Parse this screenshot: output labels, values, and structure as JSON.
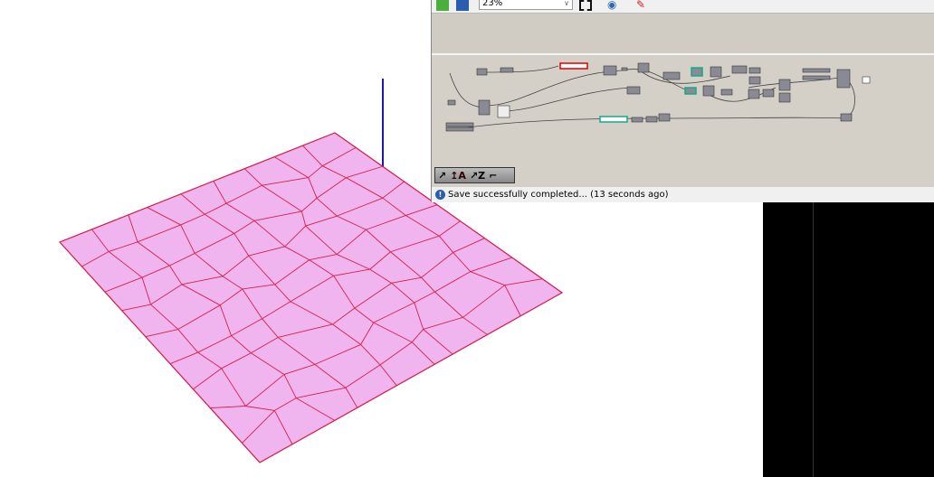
{
  "toolbar": {
    "zoom_value": "23%",
    "icons": [
      "open-file-icon",
      "save-icon",
      "zoom-extents-icon",
      "preview-eye-icon",
      "sketch-pen-icon"
    ]
  },
  "widgets": [
    "align-icon",
    "text-icon",
    "z-sort-icon",
    "wire-icon"
  ],
  "widget_glyphs": [
    "↗",
    "↥A",
    "↗Z",
    "⌐"
  ],
  "status": {
    "message": "Save successfully completed... (13 seconds ago)"
  },
  "colors": {
    "surface": "#f0b4ee",
    "cell_edge": "#d8204a",
    "axis": "#1a1ab0",
    "canvas": "#d4d0c8"
  }
}
